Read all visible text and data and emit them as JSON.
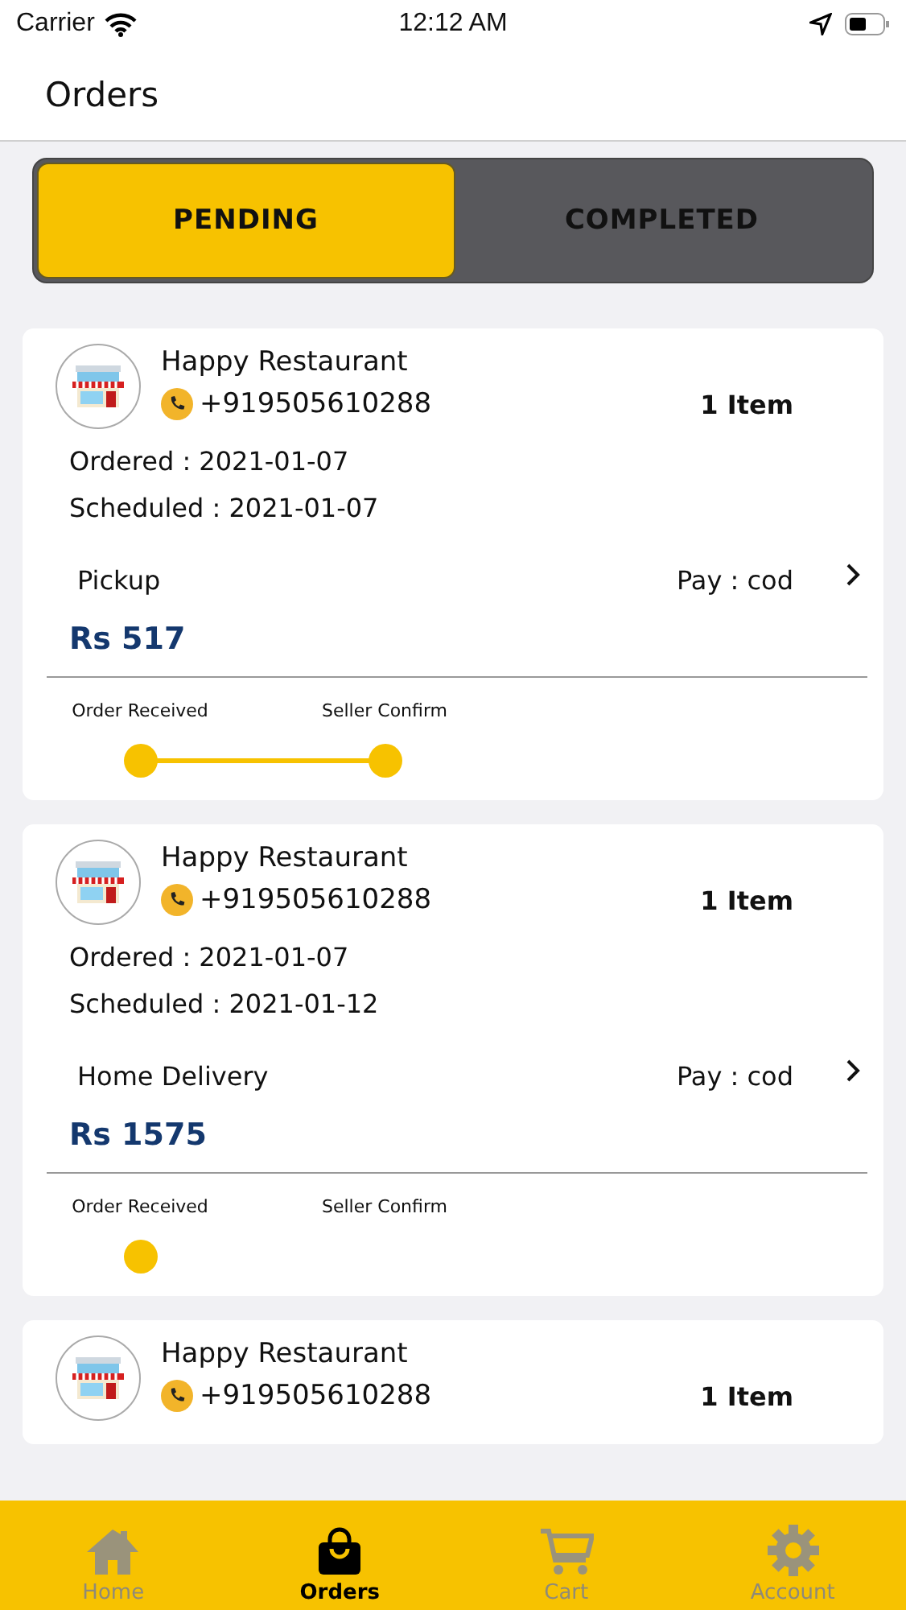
{
  "status_bar": {
    "carrier": "Carrier",
    "time": "12:12 AM"
  },
  "header": {
    "title": "Orders"
  },
  "tabs": [
    {
      "label": "PENDING",
      "selected": true
    },
    {
      "label": "COMPLETED",
      "selected": false
    }
  ],
  "orders": [
    {
      "name": "Happy Restaurant",
      "phone": "+919505610288",
      "items": "1 Item",
      "ordered": "Ordered : 2021-01-07",
      "scheduled": "Scheduled : 2021-01-07",
      "method": "Pickup",
      "pay": "Pay : cod",
      "total": "Rs 517",
      "steps": [
        {
          "label": "Order Received",
          "done": true
        },
        {
          "label": "Seller Confirm",
          "done": true
        }
      ]
    },
    {
      "name": "Happy Restaurant",
      "phone": "+919505610288",
      "items": "1 Item",
      "ordered": "Ordered : 2021-01-07",
      "scheduled": "Scheduled : 2021-01-12",
      "method": "Home Delivery",
      "pay": "Pay : cod",
      "total": "Rs 1575",
      "steps": [
        {
          "label": "Order Received",
          "done": true
        },
        {
          "label": "Seller Confirm",
          "done": false
        }
      ]
    },
    {
      "name": "Happy Restaurant",
      "phone": "+919505610288",
      "items": "1 Item"
    }
  ],
  "tab_bar": [
    {
      "label": "Home",
      "selected": false
    },
    {
      "label": "Orders",
      "selected": true
    },
    {
      "label": "Cart",
      "selected": false
    },
    {
      "label": "Account",
      "selected": false
    }
  ]
}
